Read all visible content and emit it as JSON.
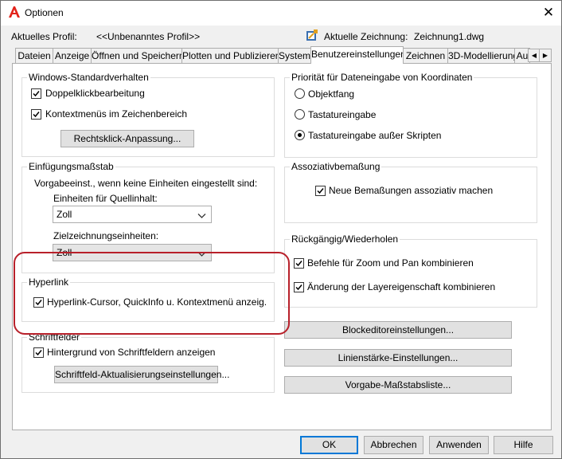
{
  "window": {
    "title": "Optionen",
    "close_symbol": "✕"
  },
  "profile": {
    "label": "Aktuelles Profil:",
    "value": "<<Unbenanntes Profil>>"
  },
  "drawing": {
    "label": "Aktuelle Zeichnung:",
    "value": "Zeichnung1.dwg",
    "icon": "drawing-icon"
  },
  "tabs": [
    "Dateien",
    "Anzeige",
    "Öffnen und Speichern",
    "Plotten und Publizieren",
    "System",
    "Benutzereinstellungen",
    "Zeichnen",
    "3D-Modellierung",
    "Au"
  ],
  "active_tab": "Benutzereinstellungen",
  "windows_group": {
    "title": "Windows-Standardverhalten",
    "dblclick": "Doppelklickbearbeitung",
    "context": "Kontextmenüs im Zeichenbereich",
    "rightclick_button": "Rechtsklick-Anpassung..."
  },
  "insert_group": {
    "title": "Einfügungsmaßstab",
    "desc": "Vorgabeeinst., wenn keine Einheiten eingestellt sind:",
    "source_label": "Einheiten für Quellinhalt:",
    "source_value": "Zoll",
    "target_label": "Zielzeichnungseinheiten:",
    "target_value": "Zoll"
  },
  "hyperlink_group": {
    "title": "Hyperlink",
    "option": "Hyperlink-Cursor, QuickInfo u. Kontextmenü anzeig."
  },
  "fields_group": {
    "title": "Schriftfelder",
    "option": "Hintergrund von Schriftfeldern anzeigen",
    "button": "Schriftfeld-Aktualisierungseinstellungen..."
  },
  "priority_group": {
    "title": "Priorität für Dateneingabe von Koordinaten",
    "options": [
      "Objektfang",
      "Tastatureingabe",
      "Tastatureingabe außer Skripten"
    ],
    "selected": "Tastatureingabe außer Skripten"
  },
  "assoc_group": {
    "title": "Assoziativbemaßung",
    "option": "Neue Bemaßungen assoziativ machen"
  },
  "undo_group": {
    "title": "Rückgängig/Wiederholen",
    "zoom": "Befehle für Zoom und Pan kombinieren",
    "layer": "Änderung der Layereigenschaft kombinieren"
  },
  "side_buttons": {
    "block": "Blockeditoreinstellungen...",
    "lineweight": "Linienstärke-Einstellungen...",
    "scale": "Vorgabe-Maßstabsliste..."
  },
  "footer": {
    "ok": "OK",
    "cancel": "Abbrechen",
    "apply": "Anwenden",
    "help": "Hilfe"
  }
}
